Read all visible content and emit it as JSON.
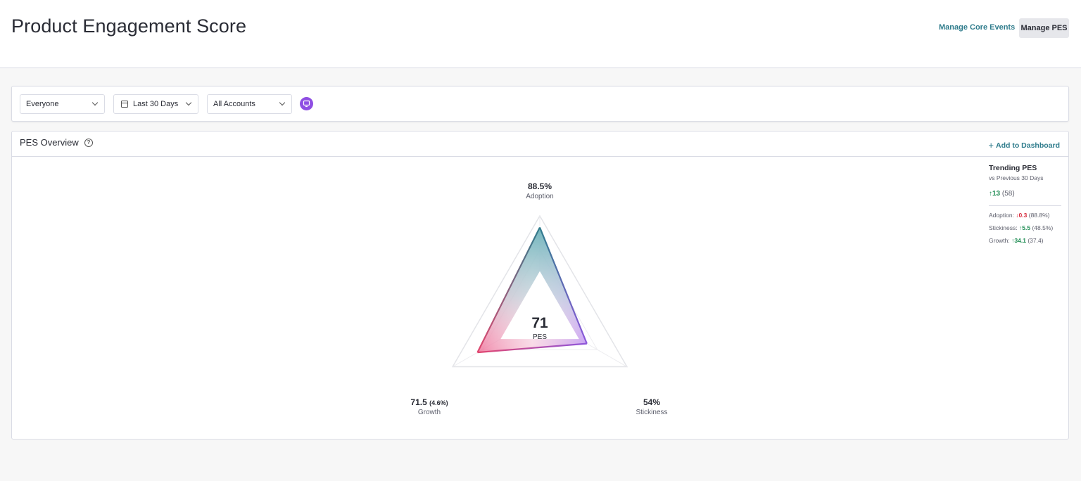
{
  "header": {
    "title": "Product Engagement Score",
    "manage_core_events": "Manage Core Events",
    "manage_pes": "Manage PES"
  },
  "filters": {
    "segment": "Everyone",
    "date_range": "Last 30 Days",
    "accounts": "All Accounts"
  },
  "panel": {
    "title": "PES Overview",
    "help_glyph": "?",
    "add_to_dashboard": "Add to Dashboard",
    "add_glyph": "+"
  },
  "score": {
    "value": "71",
    "label": "PES",
    "adoption": {
      "value": "88.5%",
      "label": "Adoption"
    },
    "growth": {
      "value": "71.5",
      "detail": "(4.6%)",
      "label": "Growth"
    },
    "stickiness": {
      "value": "54%",
      "label": "Stickiness"
    }
  },
  "trending": {
    "title": "Trending PES",
    "subtitle": "vs Previous 30 Days",
    "overall": {
      "arrow": "↑",
      "change": "13",
      "previous": "(58)"
    },
    "rows": [
      {
        "label": "Adoption:",
        "arrow": "↓",
        "change": "0.3",
        "previous": "(88.8%)",
        "direction": "down"
      },
      {
        "label": "Stickiness:",
        "arrow": "↑",
        "change": "5.5",
        "previous": "(48.5%)",
        "direction": "up"
      },
      {
        "label": "Growth:",
        "arrow": "↑",
        "change": "34.1",
        "previous": "(37.4)",
        "direction": "up"
      }
    ]
  },
  "colors": {
    "accent_teal": "#2f7c8c",
    "up_green": "#1e8c53",
    "down_red": "#d6283a",
    "segment_purple": "#8f4ee3"
  },
  "icons": [
    "chevron-down-icon",
    "calendar-icon",
    "segment-icon",
    "help-icon",
    "plus-icon",
    "arrow-up-icon",
    "arrow-down-icon"
  ]
}
